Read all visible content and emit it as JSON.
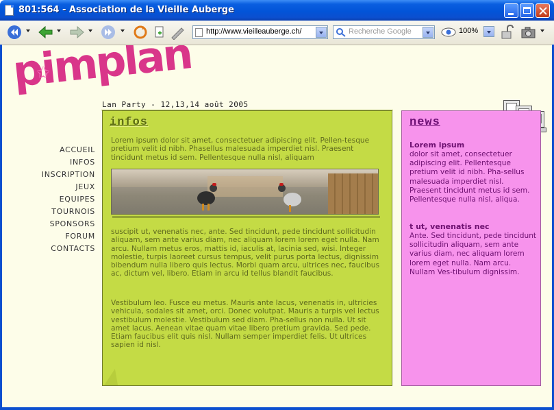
{
  "window": {
    "title": "801:564 - Association de la Vieille Auberge"
  },
  "toolbar": {
    "url": "http://www.vieilleauberge.ch/",
    "search_placeholder": "Recherche Google",
    "zoom": "100%"
  },
  "site": {
    "subtitle": "Lan Party - 12,13,14 août 2005",
    "nav": [
      "ACCUEIL",
      "INFOS",
      "INSCRIPTION",
      "JEUX",
      "EQUIPES",
      "TOURNOIS",
      "SPONSORS",
      "FORUM",
      "CONTACTS"
    ]
  },
  "infos": {
    "title": "infos",
    "para1": "Lorem ipsum dolor sit amet, consectetuer adipiscing elit. Pellen-tesque pretium velit id nibh. Phasellus malesuada imperdiet nisl. Praesent tincidunt metus id sem. Pellentesque nulla nisl, aliquam",
    "para2": "suscipit ut, venenatis nec, ante. Sed tincidunt, pede tincidunt sollicitudin aliquam, sem ante varius diam, nec aliquam lorem lorem eget nulla. Nam arcu. Nullam metus eros, mattis id, iaculis at, lacinia sed, wisi. Integer molestie, turpis laoreet cursus tempus, velit purus porta lectus, dignissim bibendum nulla libero quis lectus. Morbi quam arcu, ultrices nec, faucibus ac, dictum vel, libero. Etiam in arcu id tellus blandit faucibus.",
    "para3": "Vestibulum leo. Fusce eu metus. Mauris ante lacus, venenatis in, ultricies vehicula, sodales sit amet, orci. Donec volutpat. Mauris a turpis vel lectus vestibulum molestie. Vestibulum sed diam. Pha-sellus non nulla. Ut sit amet lacus. Aenean vitae quam vitae libero pretium gravida. Sed pede. Etiam faucibus elit quis nisl. Nullam semper imperdiet felis. Ut ultrices sapien id nisl."
  },
  "news": {
    "title": "news",
    "entries": [
      {
        "title": "Lorem ipsum",
        "text": "dolor sit amet, consectetuer adipiscing elit. Pellentesque pretium velit id nibh. Pha-sellus malesuada imperdiet nisl. Praesent tincidunt metus id sem. Pellentesque nulla nisl, aliqua."
      },
      {
        "title": "t ut, venenatis nec",
        "text": "Ante. Sed tincidunt, pede tincidunt sollicitudin aliquam, sem ante varius diam, nec aliquam lorem lorem eget nulla. Nam arcu. Nullam Ves-tibulum dignissim."
      }
    ]
  },
  "logo": "pimplan",
  "colors": {
    "titlebar": "#0254d8",
    "page_bg": "#fdfde9",
    "infos_bg": "#c4db45",
    "news_bg": "#f793ec",
    "logo": "#d9368a"
  }
}
